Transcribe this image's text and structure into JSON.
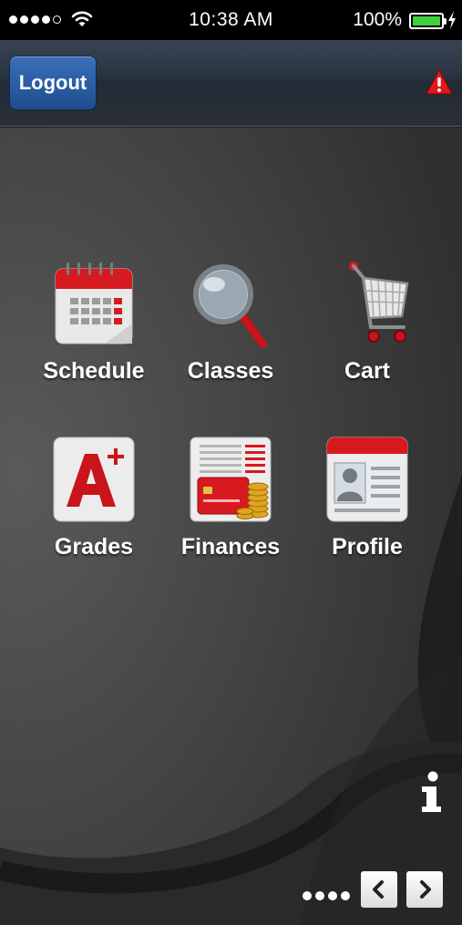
{
  "status_bar": {
    "time": "10:38 AM",
    "battery_percent": "100%",
    "signal_bars": 4,
    "signal_max": 5
  },
  "nav_bar": {
    "logout_label": "Logout",
    "alert_icon": "warning-icon"
  },
  "tiles": [
    {
      "label": "Schedule",
      "icon": "calendar-icon"
    },
    {
      "label": "Classes",
      "icon": "magnifier-icon"
    },
    {
      "label": "Cart",
      "icon": "shopping-cart-icon"
    },
    {
      "label": "Grades",
      "icon": "grade-a-plus-icon"
    },
    {
      "label": "Finances",
      "icon": "credit-card-coins-icon"
    },
    {
      "label": "Profile",
      "icon": "id-card-icon"
    }
  ],
  "footer": {
    "info_icon": "info-icon",
    "page_count": 4
  },
  "colors": {
    "accent_red": "#d71920",
    "button_blue": "#2a5ea6",
    "battery_green": "#3ed23e"
  }
}
